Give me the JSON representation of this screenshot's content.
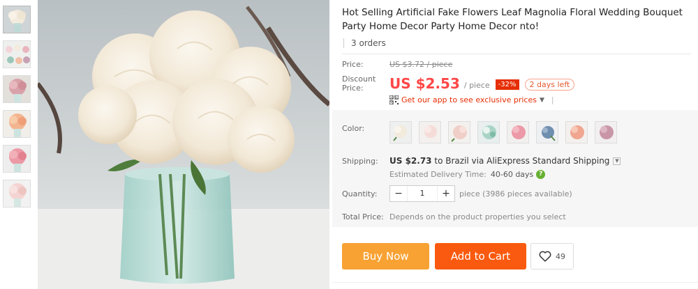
{
  "product": {
    "title": "Hot Selling Artificial Fake Flowers Leaf Magnolia Floral Wedding Bouquet Party Home Decor Party Home Decor nto!",
    "orders": "3 orders"
  },
  "price": {
    "label": "Price:",
    "original": "US $3.72 / piece",
    "discount_label": "Discount Price:",
    "current": "US $2.53",
    "unit": "/ piece",
    "discount_pct": "-32%",
    "days_left": "2 days left",
    "app_promo": "Get our app to see exclusive prices"
  },
  "color": {
    "label": "Color:",
    "swatches": [
      "cream",
      "light-pink",
      "pale-pink",
      "green-white",
      "pink",
      "blue",
      "peach",
      "mauve"
    ]
  },
  "shipping": {
    "label": "Shipping:",
    "cost": "US $2.73",
    "to_text": "to Brazil via AliExpress Standard Shipping",
    "delivery_label": "Estimated Delivery Time:",
    "delivery_days": "40-60 days"
  },
  "quantity": {
    "label": "Quantity:",
    "minus": "−",
    "value": "1",
    "plus": "+",
    "available": "piece (3986 pieces available)"
  },
  "total": {
    "label": "Total Price:",
    "value": "Depends on the product properties you select"
  },
  "actions": {
    "buy_now": "Buy Now",
    "add_to_cart": "Add to Cart",
    "wishlist_count": "49"
  },
  "colors": {
    "price_red": "#ff4747",
    "buy_now_bg": "#f8a233",
    "add_cart_bg": "#fa5a0f"
  }
}
